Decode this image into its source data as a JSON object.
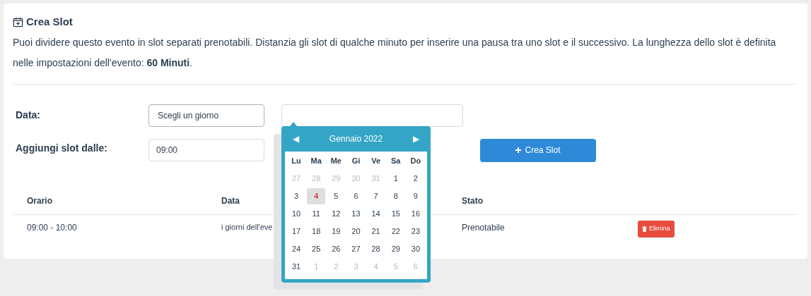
{
  "section": {
    "title": "Crea Slot",
    "description": "Puoi dividere questo evento in slot separati prenotabili. Distanzia gli slot di qualche minuto per inserire una pausa tra uno slot e il successivo. La lunghezza dello slot è definita nelle impostazioni dell'evento: **60 Minuti**."
  },
  "form": {
    "date_label": "Data:",
    "date_value": "Scegli un giorno",
    "start_label": "Aggiungi slot dalle:",
    "start_value": "09:00",
    "create_button": "Crea Slot"
  },
  "calendar": {
    "prev": "◀",
    "next": "▶",
    "month": "Gennaio 2022",
    "weekdays": [
      "Lu",
      "Ma",
      "Me",
      "Gi",
      "Ve",
      "Sa",
      "Do"
    ],
    "days": [
      {
        "label": "27",
        "outside": true,
        "selected": false
      },
      {
        "label": "28",
        "outside": true,
        "selected": false
      },
      {
        "label": "29",
        "outside": true,
        "selected": false
      },
      {
        "label": "30",
        "outside": true,
        "selected": false
      },
      {
        "label": "31",
        "outside": true,
        "selected": false
      },
      {
        "label": "1",
        "outside": false,
        "selected": false
      },
      {
        "label": "2",
        "outside": false,
        "selected": false
      },
      {
        "label": "3",
        "outside": false,
        "selected": false
      },
      {
        "label": "4",
        "outside": false,
        "selected": true
      },
      {
        "label": "5",
        "outside": false,
        "selected": false
      },
      {
        "label": "6",
        "outside": false,
        "selected": false
      },
      {
        "label": "7",
        "outside": false,
        "selected": false
      },
      {
        "label": "8",
        "outside": false,
        "selected": false
      },
      {
        "label": "9",
        "outside": false,
        "selected": false
      },
      {
        "label": "10",
        "outside": false,
        "selected": false
      },
      {
        "label": "11",
        "outside": false,
        "selected": false
      },
      {
        "label": "12",
        "outside": false,
        "selected": false
      },
      {
        "label": "13",
        "outside": false,
        "selected": false
      },
      {
        "label": "14",
        "outside": false,
        "selected": false
      },
      {
        "label": "15",
        "outside": false,
        "selected": false
      },
      {
        "label": "16",
        "outside": false,
        "selected": false
      },
      {
        "label": "17",
        "outside": false,
        "selected": false
      },
      {
        "label": "18",
        "outside": false,
        "selected": false
      },
      {
        "label": "19",
        "outside": false,
        "selected": false
      },
      {
        "label": "20",
        "outside": false,
        "selected": false
      },
      {
        "label": "21",
        "outside": false,
        "selected": false
      },
      {
        "label": "22",
        "outside": false,
        "selected": false
      },
      {
        "label": "23",
        "outside": false,
        "selected": false
      },
      {
        "label": "24",
        "outside": false,
        "selected": false
      },
      {
        "label": "25",
        "outside": false,
        "selected": false
      },
      {
        "label": "26",
        "outside": false,
        "selected": false
      },
      {
        "label": "27",
        "outside": false,
        "selected": false
      },
      {
        "label": "28",
        "outside": false,
        "selected": false
      },
      {
        "label": "29",
        "outside": false,
        "selected": false
      },
      {
        "label": "30",
        "outside": false,
        "selected": false
      },
      {
        "label": "31",
        "outside": false,
        "selected": false
      },
      {
        "label": "1",
        "outside": true,
        "selected": false
      },
      {
        "label": "2",
        "outside": true,
        "selected": false
      },
      {
        "label": "3",
        "outside": true,
        "selected": false
      },
      {
        "label": "4",
        "outside": true,
        "selected": false
      },
      {
        "label": "5",
        "outside": true,
        "selected": false
      },
      {
        "label": "6",
        "outside": true,
        "selected": false
      }
    ]
  },
  "table": {
    "columns": [
      "Orario",
      "Data",
      "Stato"
    ],
    "rows": [
      {
        "time": "09:00 - 10:00",
        "date": "i giorni dell'eve",
        "status": "Prenotabile",
        "action": "Elimina"
      }
    ]
  }
}
